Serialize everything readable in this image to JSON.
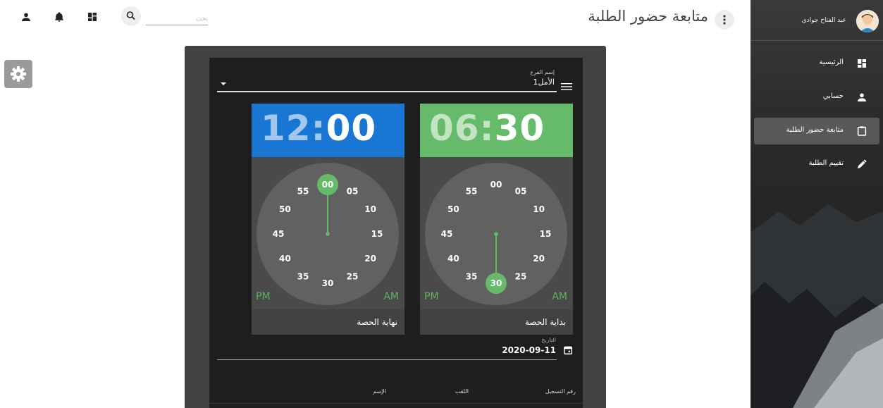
{
  "sidebar": {
    "user_name": "عبد الفتاح جوادى",
    "items": [
      {
        "label": "الرئيسية",
        "icon": "dashboard-icon",
        "active": false
      },
      {
        "label": "حسابي",
        "icon": "person-icon",
        "active": false
      },
      {
        "label": "متابعة حضور الطلبة",
        "icon": "clipboard-icon",
        "active": true
      },
      {
        "label": "تقييم الطلبة",
        "icon": "pencil-icon",
        "active": false
      }
    ]
  },
  "header": {
    "title": "متابعة حضور الطلبة",
    "search_placeholder": "بحث"
  },
  "form": {
    "branch_label": "إسم الفرع",
    "branch_value": "الأمل1",
    "end_clock": {
      "hours": "12",
      "minutes": "00",
      "selected_minute": "00",
      "label": "نهاية الحصة",
      "pm": "PM",
      "am": "AM"
    },
    "start_clock": {
      "hours": "06",
      "minutes": "30",
      "selected_minute": "30",
      "label": "بداية الحصة",
      "pm": "PM",
      "am": "AM"
    },
    "dial_numbers": [
      "00",
      "05",
      "10",
      "15",
      "20",
      "25",
      "30",
      "35",
      "40",
      "45",
      "50",
      "55"
    ],
    "date_label": "التاريخ",
    "date_value": "2020-09-11"
  },
  "table": {
    "headers": [
      "رقم التسجيل",
      "اللقب",
      "الإسم"
    ]
  },
  "colors": {
    "end_header": "#1976d2",
    "start_header": "#66bb6a",
    "accent_green": "#66bb6a",
    "dial_face": "#616161"
  }
}
